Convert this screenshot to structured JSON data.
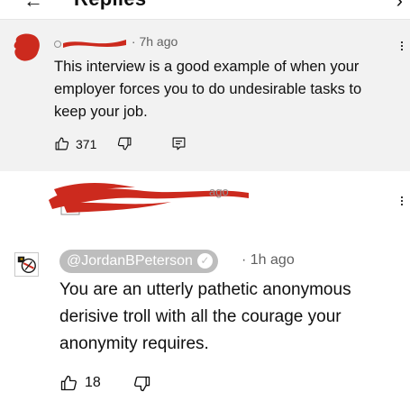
{
  "header": {
    "title": "Replies",
    "back_icon": "back-arrow-icon",
    "close_icon": "close-icon"
  },
  "parent_comment": {
    "author": "",
    "timestamp": "· 7h ago",
    "text": "This interview is a good example of when your employer forces you to do undesirable tasks to keep your job.",
    "like_count": "371",
    "icons": [
      "thumbs-up-icon",
      "thumbs-down-icon",
      "reply-icon",
      "more-options-icon"
    ]
  },
  "redacted_reply": {
    "timestamp": "ago"
  },
  "reply": {
    "author": "@JordanBPeterson",
    "verified_icon": "check-icon",
    "timestamp": "· 1h ago",
    "text": "You are an utterly pathetic anonymous derisive troll with all the courage your anonymity requires.",
    "like_count": "18",
    "icons": [
      "thumbs-up-icon",
      "thumbs-down-icon"
    ]
  },
  "colors": {
    "highlight_bg": "#f2f2f2",
    "badge_bg": "#bdbdbd",
    "redaction": "#cc2a1e"
  }
}
